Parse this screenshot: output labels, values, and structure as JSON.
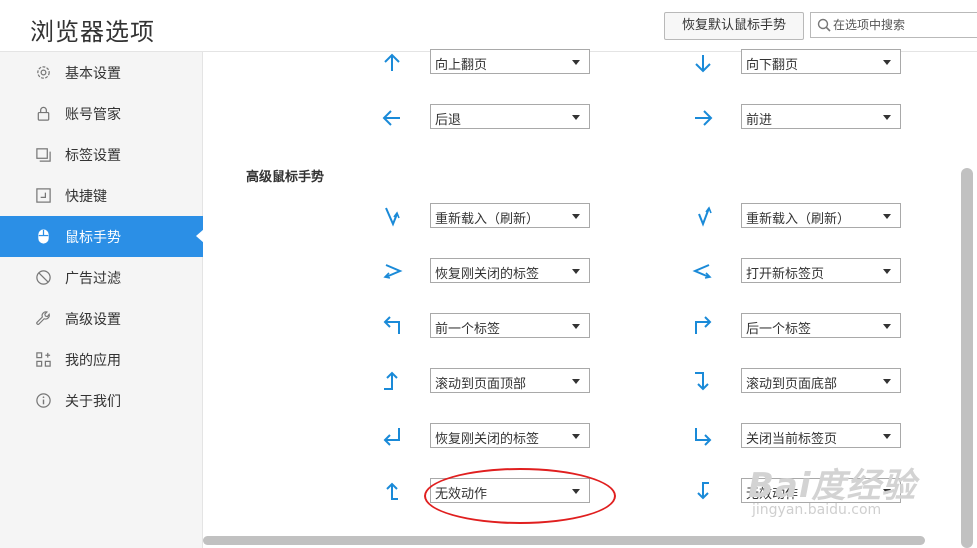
{
  "header": {
    "title": "浏览器选项",
    "restore_button": "恢复默认鼠标手势",
    "search_placeholder": "在选项中搜索"
  },
  "sidebar": {
    "items": [
      {
        "label": "基本设置",
        "icon": "gear-icon"
      },
      {
        "label": "账号管家",
        "icon": "lock-icon"
      },
      {
        "label": "标签设置",
        "icon": "tabs-icon"
      },
      {
        "label": "快捷键",
        "icon": "keyboard-icon"
      },
      {
        "label": "鼠标手势",
        "icon": "mouse-icon",
        "active": true
      },
      {
        "label": "广告过滤",
        "icon": "block-icon"
      },
      {
        "label": "高级设置",
        "icon": "wrench-icon"
      },
      {
        "label": "我的应用",
        "icon": "apps-icon"
      },
      {
        "label": "关于我们",
        "icon": "info-icon"
      }
    ]
  },
  "basic_gestures": [
    {
      "left_icon": "arrow-up-icon",
      "left_value": "向上翻页",
      "right_icon": "arrow-down-icon",
      "right_value": "向下翻页"
    },
    {
      "left_icon": "arrow-left-icon",
      "left_value": "后退",
      "right_icon": "arrow-right-icon",
      "right_value": "前进"
    }
  ],
  "advanced": {
    "title": "高级鼠标手势",
    "rows": [
      {
        "left_icon": "gesture-down-up-icon",
        "left_value": "重新载入（刷新）",
        "right_icon": "gesture-up-down-icon",
        "right_value": "重新载入（刷新）"
      },
      {
        "left_icon": "gesture-right-left-icon",
        "left_value": "恢复刚关闭的标签",
        "right_icon": "gesture-left-right-icon",
        "right_value": "打开新标签页"
      },
      {
        "left_icon": "gesture-up-left-icon",
        "left_value": "前一个标签",
        "right_icon": "gesture-up-right-icon",
        "right_value": "后一个标签"
      },
      {
        "left_icon": "gesture-left-up-icon",
        "left_value": "滚动到页面顶部",
        "right_icon": "gesture-right-down-icon",
        "right_value": "滚动到页面底部"
      },
      {
        "left_icon": "gesture-up-left-return-icon",
        "left_value": "恢复刚关闭的标签",
        "right_icon": "gesture-down-right-icon",
        "right_value": "关闭当前标签页"
      },
      {
        "left_icon": "gesture-left-up-short-icon",
        "left_value": "无效动作",
        "right_icon": "gesture-right-down-short-icon",
        "right_value": "无效动作"
      }
    ]
  },
  "watermark": {
    "main": "Bai度经验",
    "sub": "jingyan.baidu.com"
  },
  "colors": {
    "accent": "#2b8fe6",
    "icon_blue": "#1a8ad8",
    "highlight_red": "#e01f1f"
  }
}
